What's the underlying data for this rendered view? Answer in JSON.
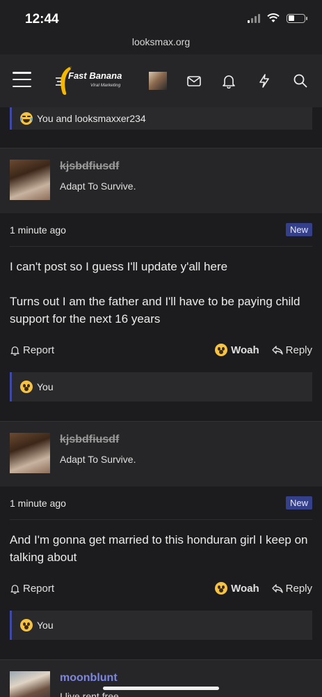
{
  "status": {
    "time": "12:44"
  },
  "browser": {
    "url": "looksmax.org"
  },
  "nav": {
    "brand": "Fast Banana",
    "brand_sub": "Viral Marketing"
  },
  "prev_reactions": "You and looksmaxxer234",
  "posts": [
    {
      "username": "kjsbdfiusdf",
      "user_title": "Adapt To Survive.",
      "date": "1 minute ago",
      "badge": "New",
      "paragraphs": [
        "I can't post so I guess I'll update y'all here",
        "Turns out I am the father and I'll have to be paying child support for the next 16 years"
      ],
      "report": "Report",
      "reaction": "Woah",
      "reply": "Reply",
      "reactions_by": "You"
    },
    {
      "username": "kjsbdfiusdf",
      "user_title": "Adapt To Survive.",
      "date": "1 minute ago",
      "badge": "New",
      "paragraphs": [
        "And I'm gonna get married to this honduran girl I keep on talking about"
      ],
      "report": "Report",
      "reaction": "Woah",
      "reply": "Reply",
      "reactions_by": "You"
    },
    {
      "username": "moonblunt",
      "user_title": "I live rent free"
    }
  ],
  "colors": {
    "accent": "#3f4aa8",
    "badge": "#34408a",
    "username_active": "#7c86e0"
  }
}
